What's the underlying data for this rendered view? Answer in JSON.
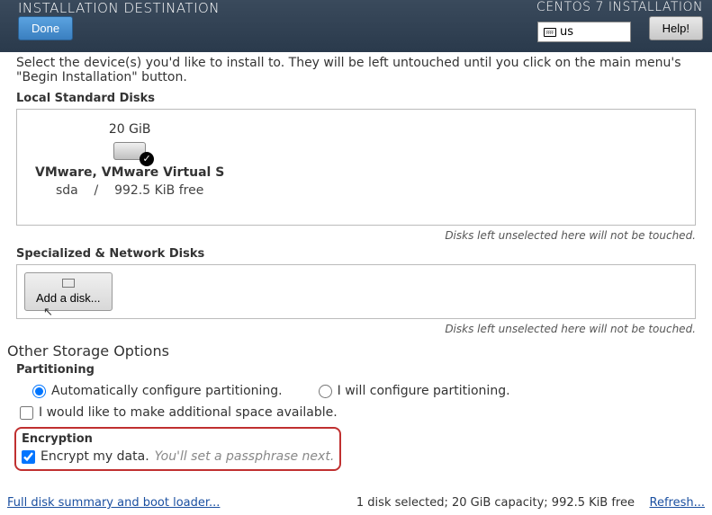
{
  "header": {
    "title": "INSTALLATION DESTINATION",
    "subtitle": "CENTOS 7 INSTALLATION",
    "done": "Done",
    "lang": "us",
    "help": "Help!"
  },
  "intro": "Select the device(s) you'd like to install to. They will be left untouched until you click on the main menu's \"Begin Installation\" button.",
  "local_label": "Local Standard Disks",
  "disk": {
    "size": "20 GiB",
    "name": "VMware, VMware Virtual S",
    "dev": "sda",
    "sep": "/",
    "free": "992.5 KiB free"
  },
  "hint_local": "Disks left unselected here will not be touched.",
  "net_label": "Specialized & Network Disks",
  "add_disk": "Add a disk...",
  "hint_net": "Disks left unselected here will not be touched.",
  "storage_head": "Other Storage Options",
  "partitioning": {
    "label": "Partitioning",
    "auto": "Automatically configure partitioning.",
    "manual": "I will configure partitioning.",
    "reclaim": "I would like to make additional space available."
  },
  "encryption": {
    "label": "Encryption",
    "encrypt": "Encrypt my data.",
    "hint": "You'll set a passphrase next."
  },
  "footer": {
    "summary": "Full disk summary and boot loader...",
    "status": "1 disk selected; 20 GiB capacity; 992.5 KiB free",
    "refresh": "Refresh..."
  }
}
